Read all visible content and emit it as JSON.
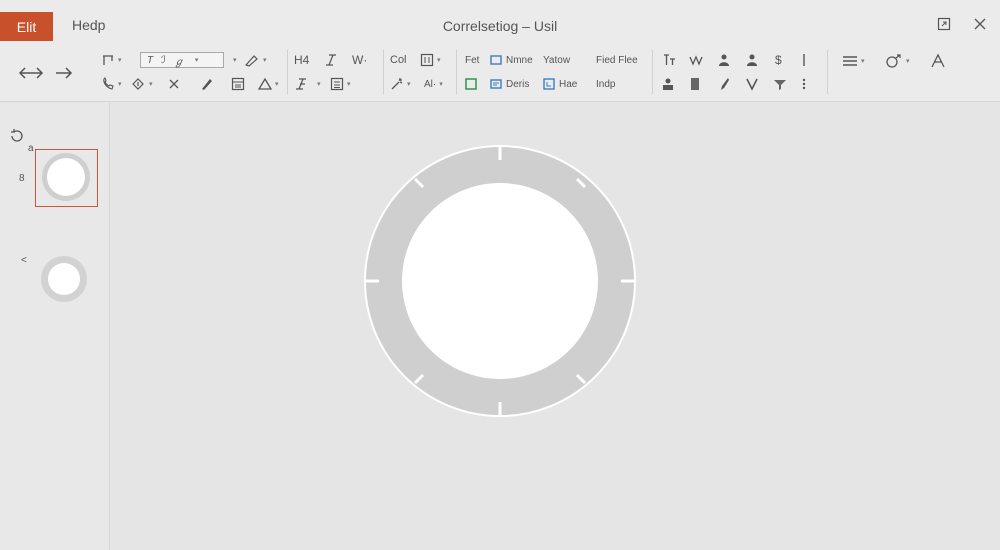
{
  "menu": {
    "file_label": "Elit",
    "help_label": "Hedp"
  },
  "window": {
    "title": "Correlsetiog – Usil",
    "restore_icon": "restore-icon",
    "close_icon": "close-icon"
  },
  "toolbar": {
    "undo_icon": "undo-arrows-icon",
    "redo_icon": "redo-arrow-icon",
    "text_box_glyphs": [
      "T",
      "ℐ",
      "ℊ"
    ],
    "labels": {
      "h4": "H4",
      "w": "W·",
      "col": "Col",
      "fet": "Fet",
      "name": "Nmne",
      "yatow": "Yatow",
      "fied_flee": "Fied Flee",
      "deris": "Deris",
      "hae": "Hae",
      "indp": "Indp",
      "al": "Al·",
      "dollar": "$"
    }
  },
  "left_panel": {
    "labels": [
      "a",
      "8",
      "<"
    ],
    "history_icon": "history-icon"
  },
  "colors": {
    "accent": "#c8502a",
    "selection": "#d2533a",
    "ring": "#cfcfcf",
    "ring_outline": "#ffffff",
    "canvas": "#e5e5e5",
    "green_icon": "#3a9a5a",
    "blue_icon": "#3a7fc0"
  }
}
